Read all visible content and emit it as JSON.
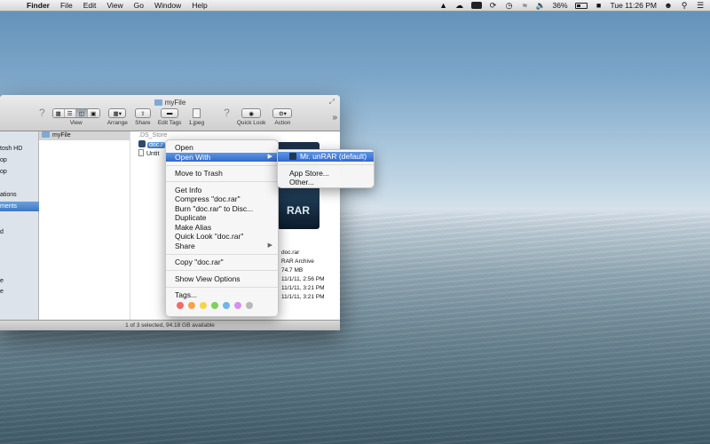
{
  "menubar": {
    "apple_glyph": "",
    "items": [
      "Finder",
      "File",
      "Edit",
      "View",
      "Go",
      "Window",
      "Help"
    ],
    "battery_percent": "36%",
    "clock": "Tue 11:26 PM"
  },
  "window": {
    "title": "myFile",
    "toolbar": {
      "view_label": "View",
      "arrange_label": "Arrange",
      "share_label": "Share",
      "edit_tags_label": "Edit Tags",
      "file_label": "1.jpeg",
      "quick_look_label": "Quick Look",
      "action_label": "Action"
    },
    "sidebar": [
      "tosh HD",
      "op",
      "op",
      "ations",
      "ments",
      "d",
      "e",
      "e"
    ],
    "column1": [
      "myFile"
    ],
    "column2": {
      "ds_store": ".DS_Store",
      "doc": "doc.r",
      "untitled": "Untit"
    },
    "preview": {
      "icon_text": "RAR",
      "name": "doc.rar",
      "kind": "RAR Archive",
      "size": "74.7 MB",
      "created": "11/1/11, 2:56 PM",
      "modified": "11/1/11, 3:21 PM",
      "opened": "11/1/11, 3:21 PM"
    },
    "status": "1 of 3 selected, 94.18 GB available"
  },
  "context_menu": {
    "open": "Open",
    "open_with": "Open With",
    "move_to_trash": "Move to Trash",
    "get_info": "Get Info",
    "compress": "Compress \"doc.rar\"",
    "burn": "Burn \"doc.rar\" to Disc...",
    "duplicate": "Duplicate",
    "make_alias": "Make Alias",
    "quick_look": "Quick Look \"doc.rar\"",
    "share": "Share",
    "copy": "Copy \"doc.rar\"",
    "show_view_options": "Show View Options",
    "tags": "Tags...",
    "tag_colors": [
      "#f26a6a",
      "#f5a34a",
      "#f2d64e",
      "#7fd15a",
      "#6cb6ef",
      "#d68ef0",
      "#b9b9b9"
    ]
  },
  "submenu": {
    "default_app": "Mr. unRAR (default)",
    "app_store": "App Store...",
    "other": "Other..."
  }
}
